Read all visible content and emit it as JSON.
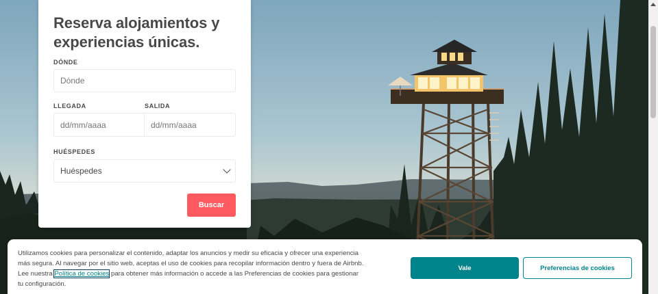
{
  "search": {
    "title": "Reserva alojamientos y experiencias únicas.",
    "where_label": "DÓNDE",
    "where_placeholder": "Dónde",
    "checkin_label": "LLEGADA",
    "checkin_placeholder": "dd/mm/aaaa",
    "checkout_label": "SALIDA",
    "checkout_placeholder": "dd/mm/aaaa",
    "guests_label": "HUÉSPEDES",
    "guests_value": "Huéspedes",
    "search_button": "Buscar"
  },
  "cookies": {
    "text_before": "Utilizamos cookies para personalizar el contenido, adaptar los anuncios y medir su eficacia y ofrecer una experiencia más segura. Al navegar por el sitio web, aceptas el uso de cookies para recopilar información dentro y fuera de Airbnb. Lee nuestra ",
    "link": "Política de cookies",
    "text_after": " para obtener más información o accede a las Preferencias de cookies para gestionar tu configuración.",
    "accept_button": "Vale",
    "prefs_button": "Preferencias de cookies"
  },
  "colors": {
    "brand_red": "#ff5a5f",
    "teal": "#00838a"
  }
}
